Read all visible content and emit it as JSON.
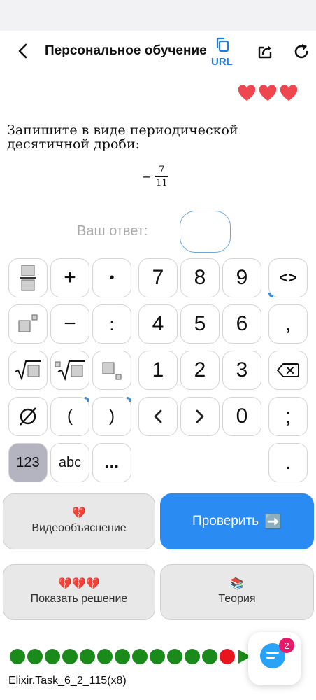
{
  "header": {
    "title": "Персональное обучение",
    "url_label": "URL"
  },
  "hearts_count": 3,
  "colors": {
    "accent_blue": "#2a8bf2",
    "heart_red": "#f04650",
    "progress_green": "#1a8a1a",
    "progress_current": "#e8141e",
    "badge_pink": "#e8196b"
  },
  "question": {
    "text": "Запишите в виде периодической десятичной дроби:",
    "expression": {
      "sign": "−",
      "numerator": "7",
      "denominator": "11"
    }
  },
  "answer": {
    "label": "Ваш ответ:",
    "value": ""
  },
  "keyboard": {
    "rows": [
      [
        "fraction-icon",
        "+",
        "•",
        "7",
        "8",
        "9",
        "<>"
      ],
      [
        "power-icon",
        "−",
        ":",
        "4",
        "5",
        "6",
        ","
      ],
      [
        "sqrt-icon",
        "nthroot-icon",
        "subscript-icon",
        "1",
        "2",
        "3",
        "backspace-icon"
      ],
      [
        "emptyset-icon",
        "(",
        ")",
        "<",
        ">",
        "0",
        ";"
      ],
      [
        "123",
        "abc",
        "..."
      ]
    ],
    "last_key": ".",
    "active_mode": "123"
  },
  "buttons": {
    "video": {
      "emoji": "💔",
      "label": "Видеообъяснение"
    },
    "check": {
      "label": "Проверить",
      "emoji": "➡️"
    },
    "solution": {
      "emoji": "💔💔💔",
      "label": "Показать решение"
    },
    "theory": {
      "emoji": "📚",
      "label": "Теория"
    }
  },
  "progress": {
    "completed": 12,
    "current_index": 12,
    "arrows": 4
  },
  "chat": {
    "badge_count": "2"
  },
  "footer": {
    "task_id": "Elixir.Task_6_2_115(x8)"
  }
}
